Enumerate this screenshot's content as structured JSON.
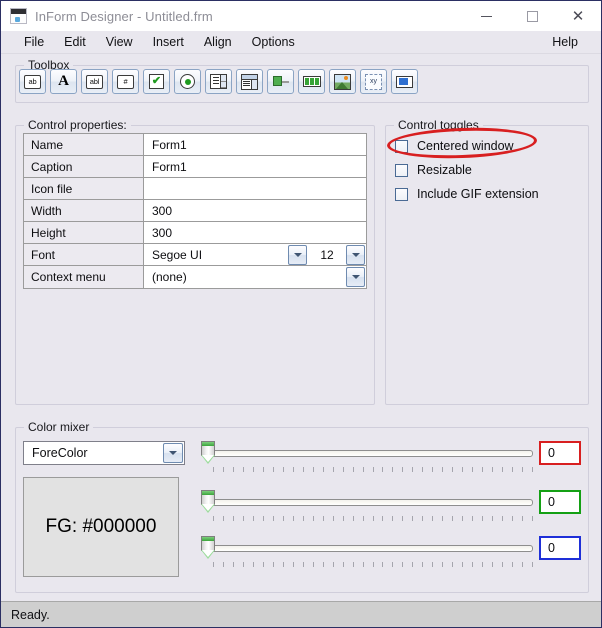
{
  "window": {
    "title": "InForm Designer - Untitled.frm",
    "icon": "form-window-icon",
    "minimize_label": "Minimize",
    "maximize_label": "Maximize",
    "close_label": "Close"
  },
  "menubar": {
    "items": [
      {
        "label": "File"
      },
      {
        "label": "Edit"
      },
      {
        "label": "View"
      },
      {
        "label": "Insert"
      },
      {
        "label": "Align"
      },
      {
        "label": "Options"
      }
    ],
    "help_label": "Help"
  },
  "toolbox": {
    "title": "Toolbox",
    "tools": [
      {
        "name": "textbox-tool",
        "glyph": "ab"
      },
      {
        "name": "label-tool",
        "glyph": "A"
      },
      {
        "name": "multiline-textbox-tool",
        "glyph": "abl"
      },
      {
        "name": "numeric-tool",
        "glyph": "#"
      },
      {
        "name": "checkbox-tool",
        "glyph": "check"
      },
      {
        "name": "radiobutton-tool",
        "glyph": "radio"
      },
      {
        "name": "listbox-tool",
        "glyph": "list"
      },
      {
        "name": "combobox-tool",
        "glyph": "combo"
      },
      {
        "name": "trackbar-tool",
        "glyph": "track"
      },
      {
        "name": "progressbar-tool",
        "glyph": "progress"
      },
      {
        "name": "picturebox-tool",
        "glyph": "picture"
      },
      {
        "name": "coordinates-tool",
        "glyph": "xy"
      },
      {
        "name": "panel-tool",
        "glyph": "panel"
      }
    ]
  },
  "control_properties": {
    "title": "Control properties:",
    "rows": [
      {
        "label": "Name",
        "value": "Form1"
      },
      {
        "label": "Caption",
        "value": "Form1"
      },
      {
        "label": "Icon file",
        "value": ""
      },
      {
        "label": "Width",
        "value": "300"
      },
      {
        "label": "Height",
        "value": "300"
      },
      {
        "label": "Font",
        "value": "Segoe UI",
        "font_size": "12"
      },
      {
        "label": "Context menu",
        "value": "(none)"
      }
    ]
  },
  "control_toggles": {
    "title": "Control toggles",
    "items": [
      {
        "label": "Centered window",
        "checked": false
      },
      {
        "label": "Resizable",
        "checked": false
      },
      {
        "label": "Include GIF extension",
        "checked": false
      }
    ],
    "annotation": {
      "name": "red-ellipse-highlight",
      "targets": "Centered window",
      "color": "#d81f20"
    }
  },
  "color_mixer": {
    "title": "Color mixer",
    "channel_select": {
      "value": "ForeColor"
    },
    "preview_text": "FG: #000000",
    "preview_color": "#000000",
    "sliders": [
      {
        "name": "red-slider",
        "value": "0",
        "accent": "#d81f20",
        "position": 0
      },
      {
        "name": "green-slider",
        "value": "0",
        "accent": "#14a014",
        "position": 0
      },
      {
        "name": "blue-slider",
        "value": "0",
        "accent": "#1e2fd8",
        "position": 0
      }
    ],
    "tick_count": 33
  },
  "statusbar": {
    "text": "Ready."
  }
}
